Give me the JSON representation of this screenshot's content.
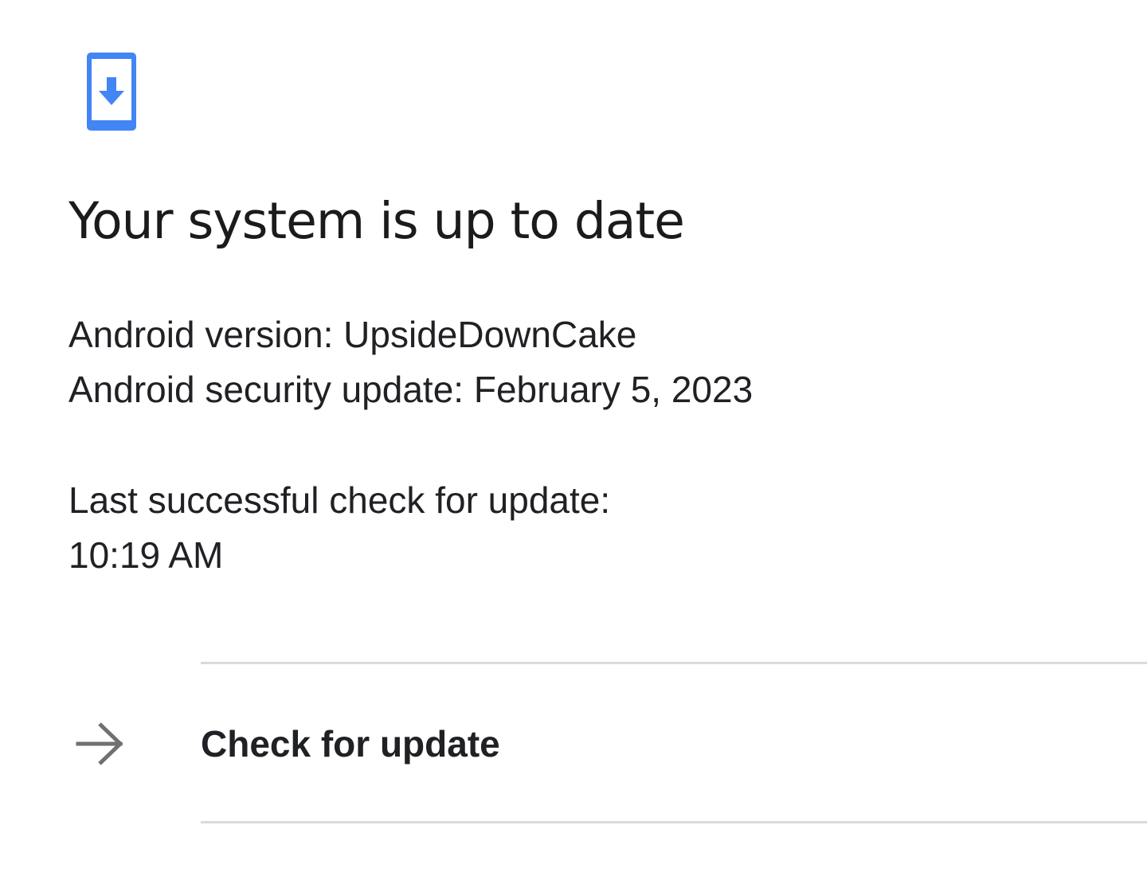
{
  "header": {
    "icon": "phone-download-icon",
    "icon_color": "#4285f4",
    "title": "Your system is up to date"
  },
  "versions": {
    "android_version": "Android version: UpsideDownCake",
    "security_update": "Android security update: February 5, 2023"
  },
  "last_check": {
    "label": "Last successful check for update:",
    "time": "10:19 AM"
  },
  "action": {
    "icon": "arrow-right-icon",
    "label": "Check for update"
  },
  "colors": {
    "accent": "#4285f4",
    "text": "#202124",
    "divider": "#dadada",
    "arrow": "#707070"
  }
}
